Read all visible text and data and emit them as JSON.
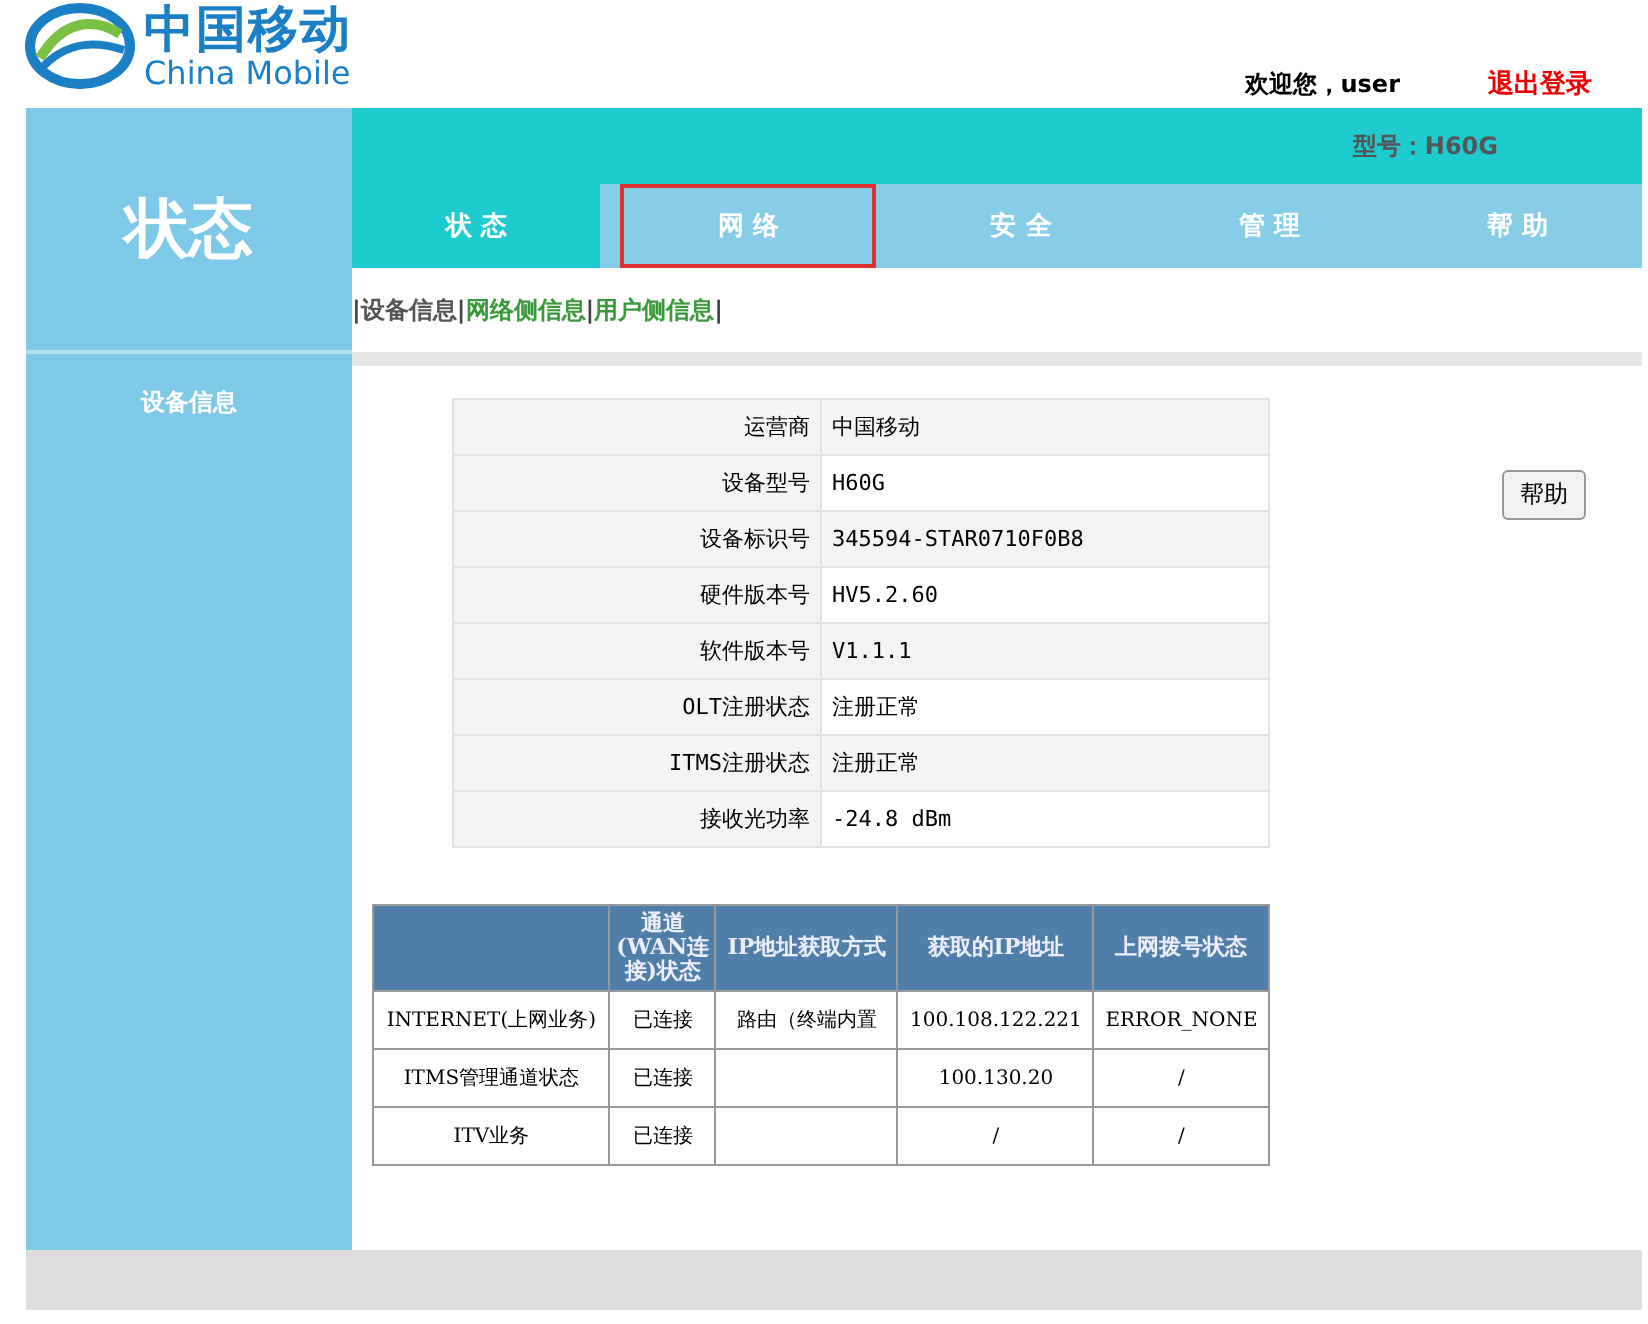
{
  "logo": {
    "name_cn": "中国移动",
    "name_en": "China Mobile"
  },
  "header": {
    "welcome": "欢迎您，user",
    "logout": "退出登录"
  },
  "page_title": "状态",
  "model": "型号：H60G",
  "tabs": [
    {
      "label": "状 态",
      "selected": true,
      "outlined": false
    },
    {
      "label": "网 络",
      "selected": false,
      "outlined": true
    },
    {
      "label": "安 全",
      "selected": false,
      "outlined": false
    },
    {
      "label": "管 理",
      "selected": false,
      "outlined": false
    },
    {
      "label": "帮 助",
      "selected": false,
      "outlined": false
    }
  ],
  "subnav": [
    {
      "label": "设备信息",
      "selected": true
    },
    {
      "label": "网络侧信息",
      "selected": false
    },
    {
      "label": "用户侧信息",
      "selected": false
    }
  ],
  "subnav_separator": "|",
  "sidebar": {
    "items": [
      {
        "label": "设备信息"
      }
    ]
  },
  "info_table": [
    {
      "label": "运营商",
      "value": "中国移动"
    },
    {
      "label": "设备型号",
      "value": "H60G"
    },
    {
      "label": "设备标识号",
      "value": "345594-STAR0710F0B8"
    },
    {
      "label": "硬件版本号",
      "value": "HV5.2.60"
    },
    {
      "label": "软件版本号",
      "value": "V1.1.1"
    },
    {
      "label": "OLT注册状态",
      "value": "注册正常"
    },
    {
      "label": "ITMS注册状态",
      "value": "注册正常"
    },
    {
      "label": "接收光功率",
      "value": "-24.8 dBm"
    }
  ],
  "help_button": "帮助",
  "wan_table": {
    "columns": [
      "",
      "通道(WAN连接)状态",
      "IP地址获取方式",
      "获取的IP地址",
      "上网拨号状态"
    ],
    "rows": [
      [
        "INTERNET(上网业务)",
        "已连接",
        "路由（终端内置",
        "100.108.122.221",
        "ERROR_NONE"
      ],
      [
        "ITMS管理通道状态",
        "已连接",
        "",
        "100.130.20",
        "/"
      ],
      [
        "ITV业务",
        "已连接",
        "",
        "/",
        "/"
      ]
    ]
  }
}
